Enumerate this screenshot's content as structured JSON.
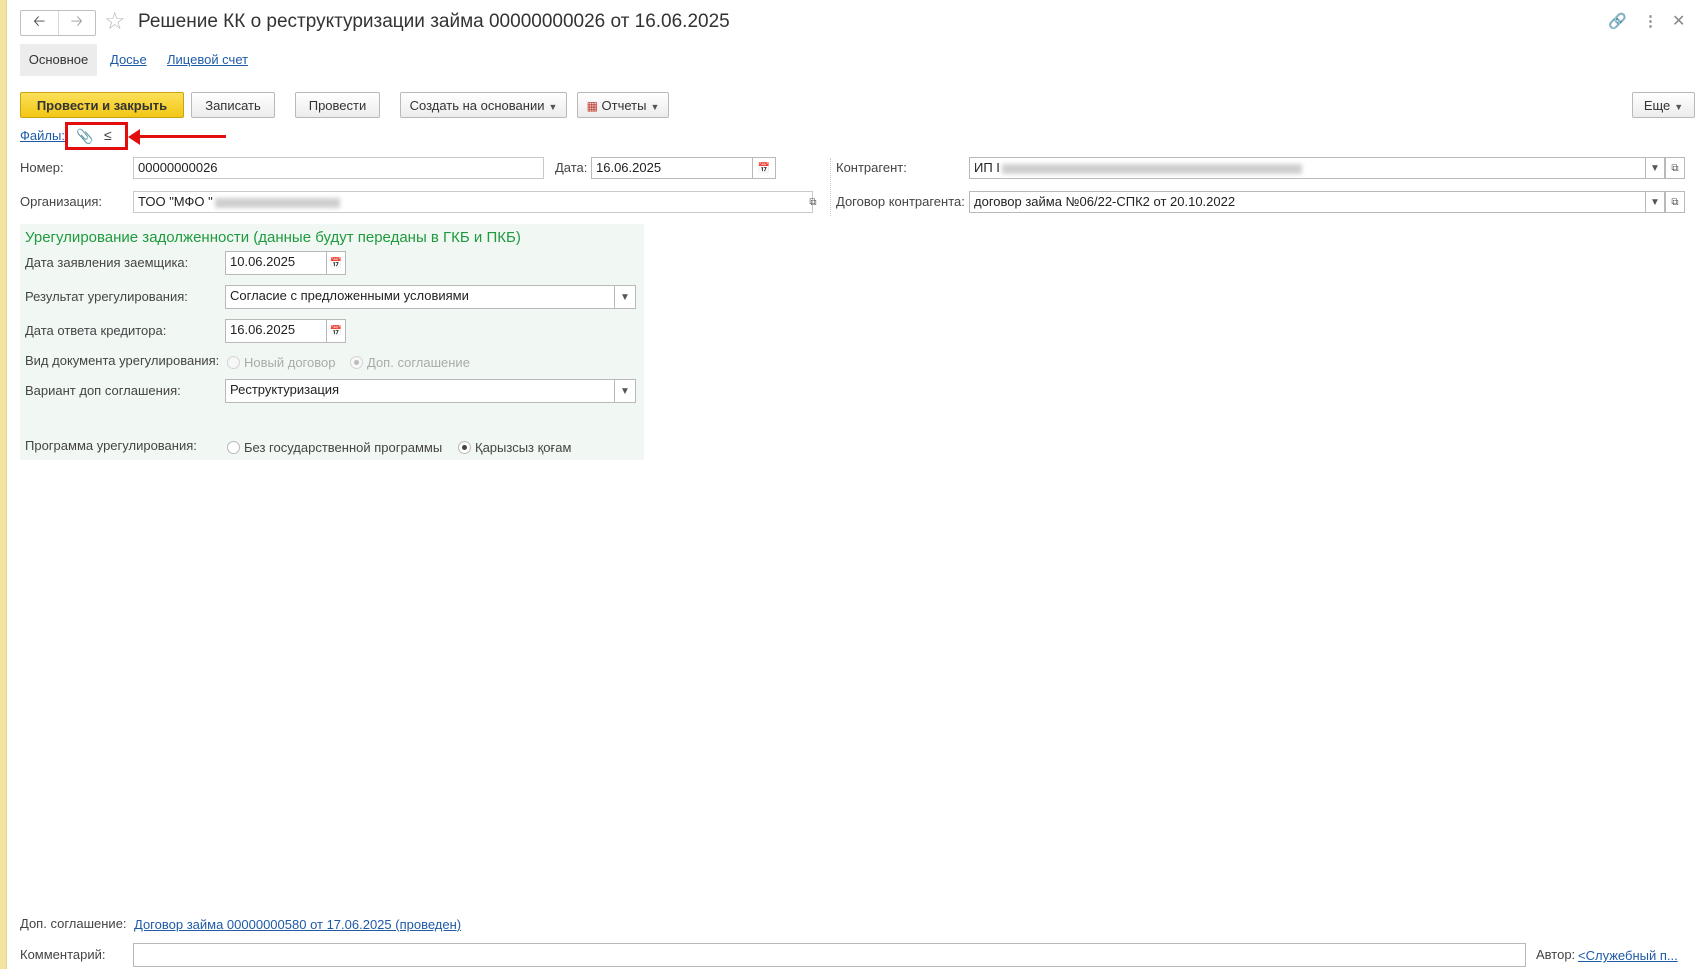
{
  "window": {
    "title": "Решение КК о реструктуризации займа 00000000026 от 16.06.2025"
  },
  "tabs": [
    {
      "label": "Основное",
      "active": true
    },
    {
      "label": "Досье",
      "active": false
    },
    {
      "label": "Лицевой счет",
      "active": false
    }
  ],
  "toolbar": {
    "post_close": "Провести и закрыть",
    "save": "Записать",
    "post": "Провести",
    "create_based": "Создать на основании",
    "reports": "Отчеты",
    "more": "Еще"
  },
  "files": {
    "label": "Файлы:"
  },
  "header_fields": {
    "number_label": "Номер:",
    "number_value": "00000000026",
    "date_label": "Дата:",
    "date_value": "16.06.2025",
    "org_label": "Организация:",
    "org_value": "ТОО \"МФО \"",
    "contractor_label": "Контрагент:",
    "contractor_value": "ИП I",
    "contract_label": "Договор контрагента:",
    "contract_value": "договор займа №06/22-СПК2 от 20.10.2022"
  },
  "settlement": {
    "title": "Урегулирование задолженности (данные будут переданы в ГКБ и ПКБ)",
    "application_date_label": "Дата заявления заемщика:",
    "application_date_value": "10.06.2025",
    "result_label": "Результат урегулирования:",
    "result_value": "Согласие с предложенными условиями",
    "reply_date_label": "Дата ответа кредитора:",
    "reply_date_value": "16.06.2025",
    "doc_kind_label": "Вид документа урегулирования:",
    "doc_kind_options": [
      "Новый договор",
      "Доп. соглашение"
    ],
    "doc_kind_selected": "Доп. соглашение",
    "variant_label": "Вариант доп соглашения:",
    "variant_value": "Реструктуризация",
    "program_label": "Программа урегулирования:",
    "program_options": [
      "Без государственной программы",
      "Қарызсыз қоғам"
    ],
    "program_selected": "Қарызсыз қоғам"
  },
  "footer": {
    "addendum_label": "Доп. соглашение:",
    "addendum_link": "Договор займа 00000000580 от 17.06.2025 (проведен)",
    "comment_label": "Комментарий:",
    "comment_value": "",
    "author_label": "Автор:",
    "author_link": "<Служебный п..."
  },
  "colors": {
    "primary_button": "#f3c614",
    "link": "#1f5aa6",
    "group_title": "#1f9a3e",
    "group_background": "#f1f8f3",
    "annotation": "#e20e0e"
  }
}
